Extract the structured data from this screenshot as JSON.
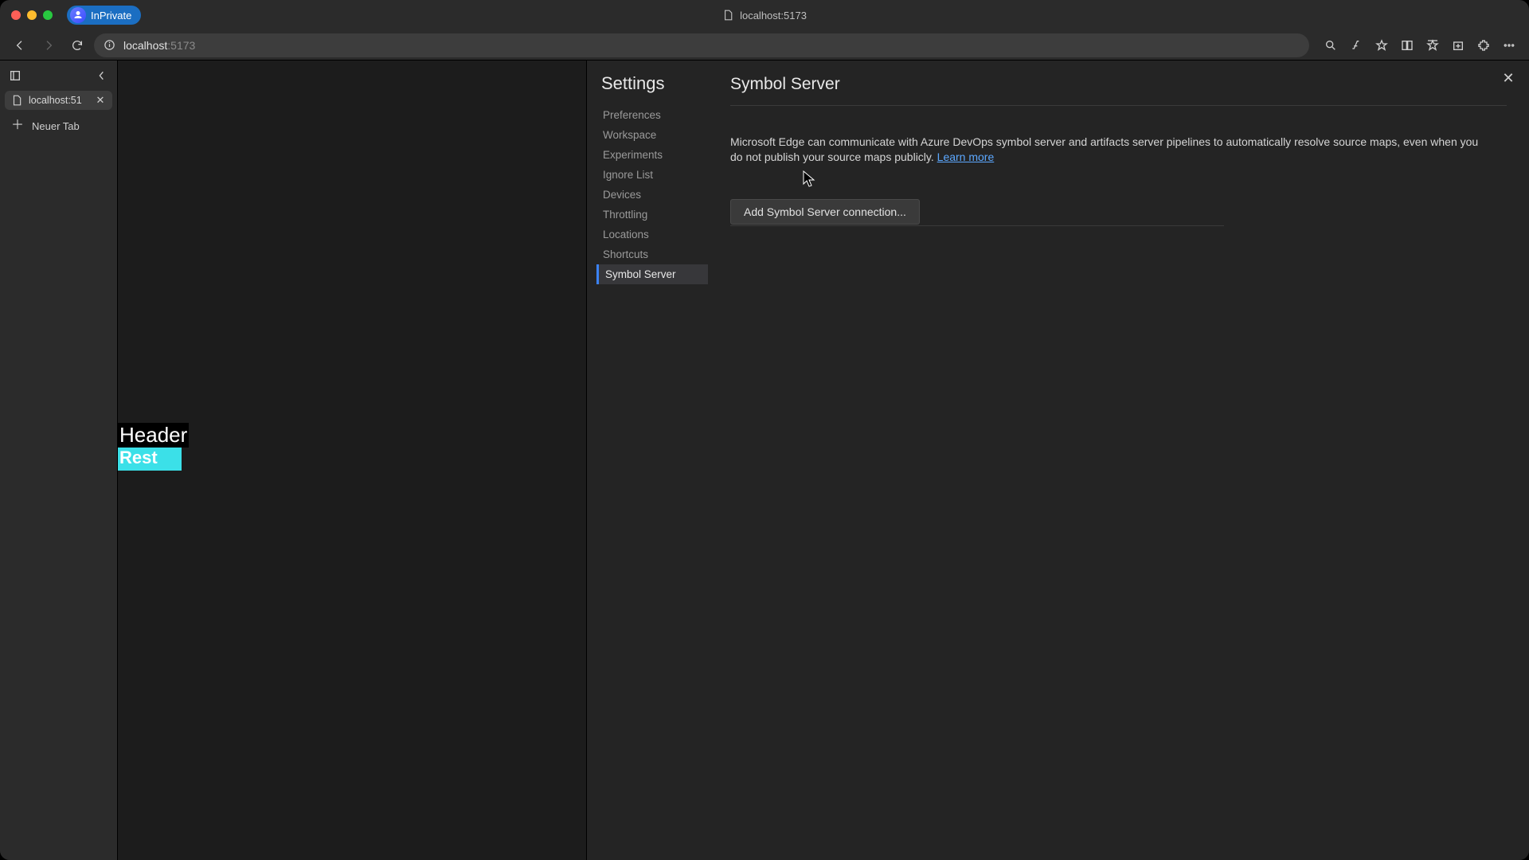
{
  "window": {
    "inprivate_label": "InPrivate",
    "title_url": "localhost:5173"
  },
  "toolbar": {
    "address_primary": "localhost",
    "address_secondary": ":5173"
  },
  "vertical_tabs": {
    "items": [
      {
        "title": "localhost:51"
      }
    ],
    "new_tab_label": "Neuer Tab"
  },
  "page": {
    "header_text": "Header",
    "rest_text": "Rest"
  },
  "devtools_settings": {
    "title": "Settings",
    "items": [
      "Preferences",
      "Workspace",
      "Experiments",
      "Ignore List",
      "Devices",
      "Throttling",
      "Locations",
      "Shortcuts",
      "Symbol Server"
    ],
    "selected_index": 8,
    "content": {
      "heading": "Symbol Server",
      "description": "Microsoft Edge can communicate with Azure DevOps symbol server and artifacts server pipelines to automatically resolve source maps, even when you do not publish your source maps publicly. ",
      "learn_more": "Learn more",
      "add_button": "Add Symbol Server connection..."
    }
  }
}
